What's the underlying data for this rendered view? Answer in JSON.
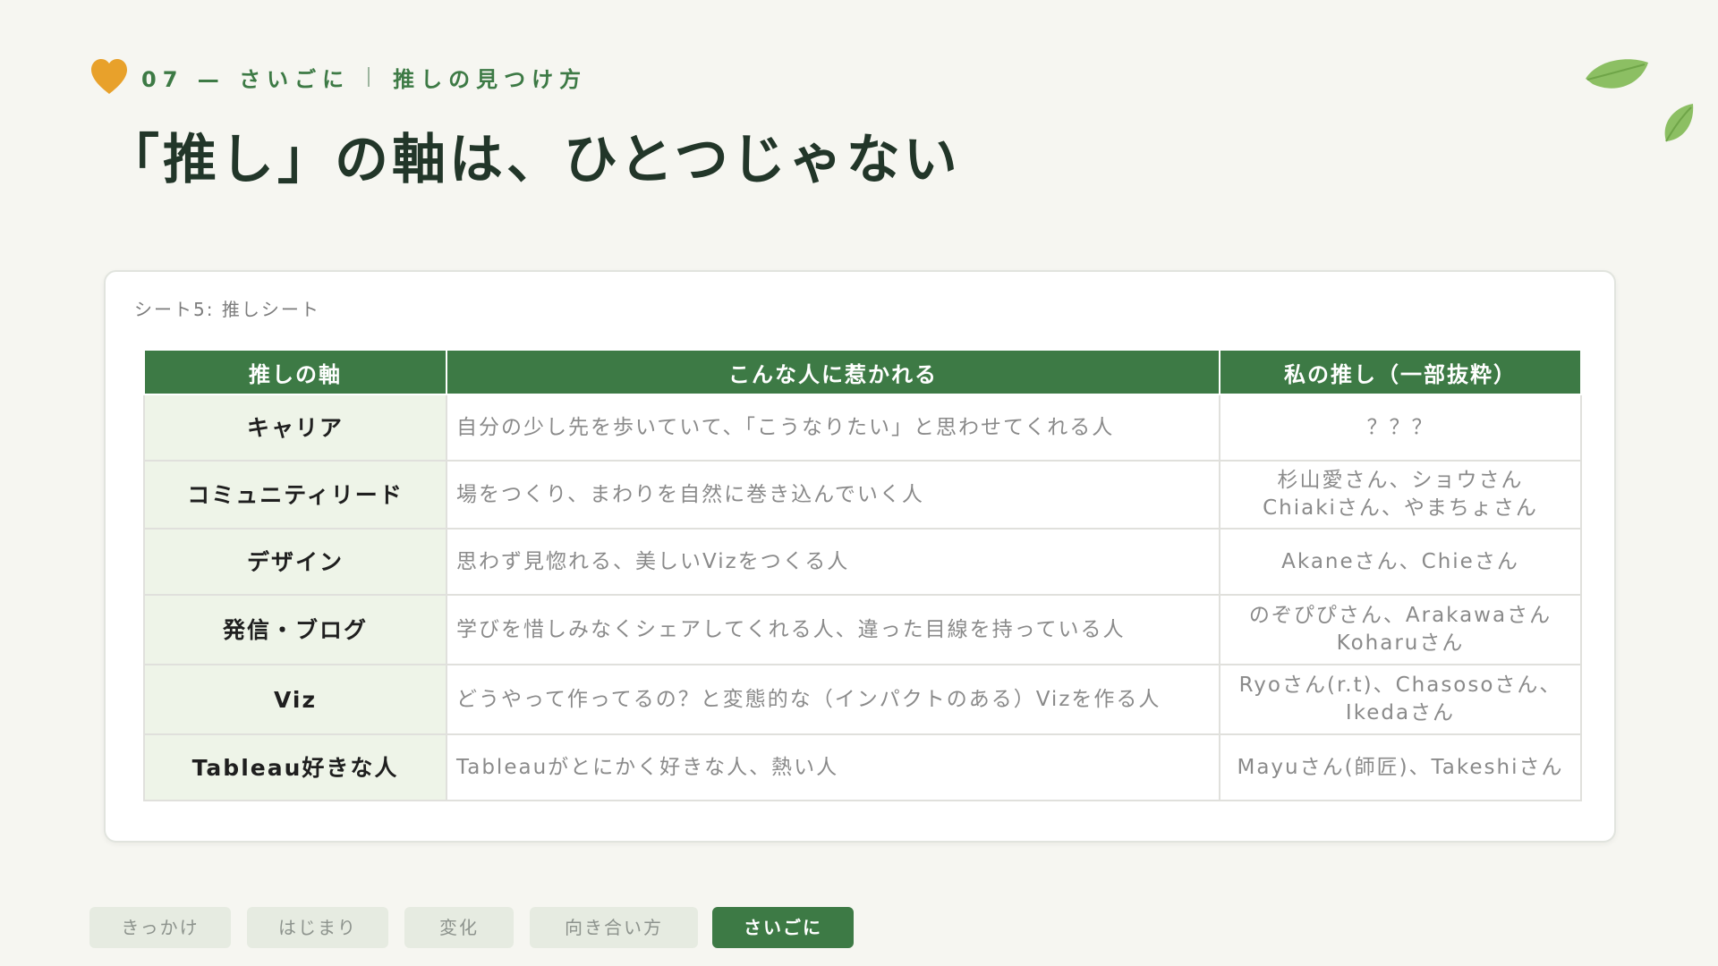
{
  "header": {
    "section": "07 — さいごに",
    "subtitle": "推しの見つけ方",
    "title": "「推し」の軸は、ひとつじゃない",
    "heart_icon": "heart-icon",
    "leaf_icons": [
      "leaf-icon",
      "leaf-icon"
    ]
  },
  "card": {
    "caption": "シート5: 推しシート",
    "columns": [
      "推しの軸",
      "こんな人に惹かれる",
      "私の推し（一部抜粋）"
    ],
    "rows": [
      {
        "axis": "キャリア",
        "description": "自分の少し先を歩いていて、「こうなりたい」と思わせてくれる人",
        "people": [
          "？？？"
        ]
      },
      {
        "axis": "コミュニティリード",
        "description": "場をつくり、まわりを自然に巻き込んでいく人",
        "people": [
          "杉山愛さん、ショウさん",
          "Chiakiさん、やまちょさん"
        ]
      },
      {
        "axis": "デザイン",
        "description": "思わず見惚れる、美しいVizをつくる人",
        "people": [
          "Akaneさん、Chieさん"
        ]
      },
      {
        "axis": "発信・ブログ",
        "description": "学びを惜しみなくシェアしてくれる人、違った目線を持っている人",
        "people": [
          "のぞぴぴさん、Arakawaさん",
          "Koharuさん"
        ]
      },
      {
        "axis": "Viz",
        "description": "どうやって作ってるの？と変態的な（インパクトのある）Vizを作る人",
        "people": [
          "Ryoさん(r.t)、Chasosoさん、",
          "Ikedaさん"
        ]
      },
      {
        "axis": "Tableau好きな人",
        "description": "Tableauがとにかく好きな人、熱い人",
        "people": [
          "Mayuさん(師匠)、Takeshiさん"
        ]
      }
    ]
  },
  "nav": {
    "tabs": [
      {
        "label": "きっかけ",
        "active": false
      },
      {
        "label": "はじまり",
        "active": false
      },
      {
        "label": "変化",
        "active": false
      },
      {
        "label": "向き合い方",
        "active": false
      },
      {
        "label": "さいごに",
        "active": true
      }
    ]
  },
  "colors": {
    "accent_green": "#3d7a45",
    "heart_orange": "#e8a12b",
    "leaf_green": "#8cbf63",
    "axis_cell_bg": "#eef4e8",
    "page_bg": "#f6f6f1"
  }
}
